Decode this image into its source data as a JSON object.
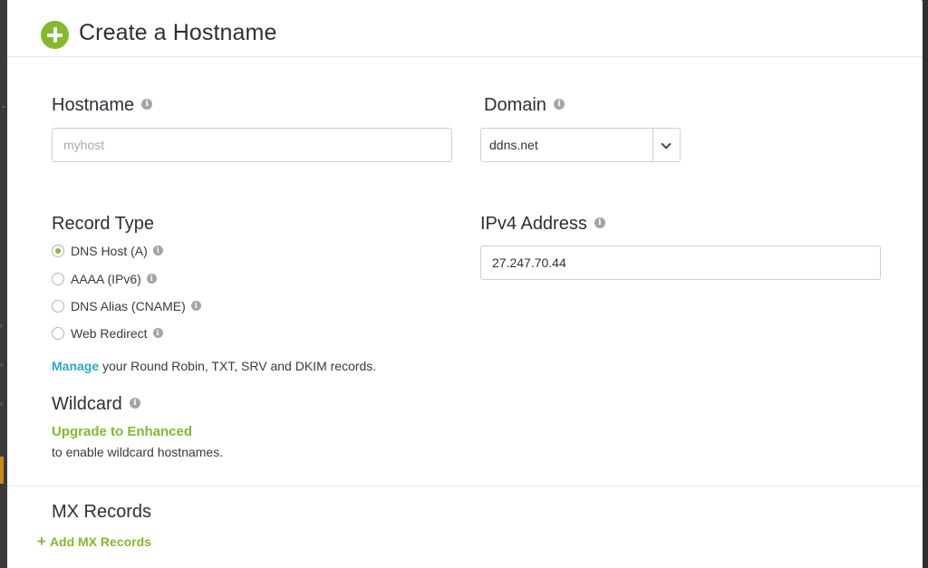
{
  "header": {
    "title": "Create a Hostname"
  },
  "hostname": {
    "label": "Hostname",
    "placeholder": "myhost"
  },
  "domain": {
    "label": "Domain",
    "value": "ddns.net"
  },
  "record_type": {
    "label": "Record Type",
    "options": [
      {
        "label": "DNS Host (A)",
        "checked": true
      },
      {
        "label": "AAAA (IPv6)",
        "checked": false
      },
      {
        "label": "DNS Alias (CNAME)",
        "checked": false
      },
      {
        "label": "Web Redirect",
        "checked": false
      }
    ],
    "manage_link": "Manage",
    "manage_text": "your Round Robin, TXT, SRV and DKIM records."
  },
  "ipv4": {
    "label": "IPv4 Address",
    "value": "27.247.70.44"
  },
  "wildcard": {
    "label": "Wildcard",
    "upgrade_link": "Upgrade to Enhanced",
    "note": "to enable wildcard hostnames."
  },
  "mx": {
    "label": "MX Records",
    "add_label": "Add MX Records"
  },
  "colors": {
    "accent_green": "#84b92e",
    "link_teal": "#2ea7c0"
  }
}
